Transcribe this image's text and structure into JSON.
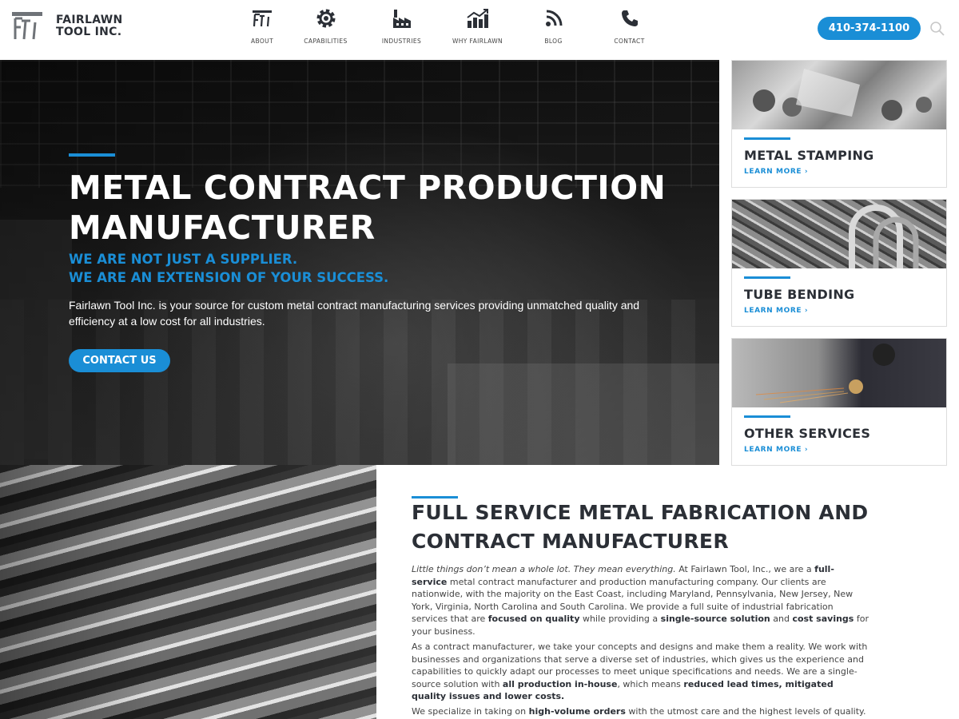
{
  "brand": {
    "line1": "FAIRLAWN",
    "line2": "TOOL INC."
  },
  "nav": [
    {
      "label": "ABOUT",
      "icon": "fti-logo-icon"
    },
    {
      "label": "CAPABILITIES",
      "icon": "gear-icon"
    },
    {
      "label": "INDUSTRIES",
      "icon": "factory-icon"
    },
    {
      "label": "WHY FAIRLAWN",
      "icon": "growth-chart-icon"
    },
    {
      "label": "BLOG",
      "icon": "rss-icon"
    },
    {
      "label": "CONTACT",
      "icon": "phone-icon"
    }
  ],
  "phone": "410-374-1100",
  "hero": {
    "title": "METAL CONTRACT PRODUCTION MANUFACTURER",
    "sub1": "WE ARE NOT JUST A SUPPLIER.",
    "sub2": "WE ARE AN EXTENSION OF YOUR SUCCESS.",
    "body": "Fairlawn Tool Inc. is your source for custom metal contract manufacturing services providing unmatched quality and efficiency at a low cost for all industries.",
    "cta": "CONTACT US"
  },
  "cards": [
    {
      "title": "METAL STAMPING",
      "link": "LEARN MORE ›"
    },
    {
      "title": "TUBE BENDING",
      "link": "LEARN MORE ›"
    },
    {
      "title": "OTHER SERVICES",
      "link": "LEARN MORE ›"
    }
  ],
  "section": {
    "title": "FULL SERVICE METAL FABRICATION AND CONTRACT MANUFACTURER",
    "p1": {
      "italic": "Little things don’t mean a whole lot. They mean everything.",
      "t1": " At Fairlawn Tool, Inc., we are a ",
      "b1": "full-service",
      "t2": " metal contract manufacturer and production manufacturing company. Our clients are nationwide, with the majority on the East Coast, including Maryland, Pennsylvania, New Jersey, New York, Virginia, North Carolina and South Carolina. We provide a full suite of industrial fabrication services that are ",
      "b2": "focused on quality",
      "t3": " while providing a ",
      "b3": "single-source solution",
      "t4": " and ",
      "b4": "cost savings",
      "t5": " for your business."
    },
    "p2": {
      "t1": "As a contract manufacturer, we take your concepts and designs and make them a reality. We work with businesses and organizations that serve a diverse set of industries, which gives us the experience and capabilities to quickly adapt our processes to meet unique specifications and needs. We are a single-source solution with ",
      "b1": "all production in-house",
      "t2": ", which means ",
      "b2": "reduced lead times, mitigated quality issues and lower costs."
    },
    "p3": {
      "t1": "We specialize in taking on ",
      "b1": "high-volume orders",
      "t2": " with the utmost care and the highest levels of quality. Our specific"
    }
  },
  "colors": {
    "accent": "#1a8ed6",
    "heading": "#2b2f36"
  }
}
